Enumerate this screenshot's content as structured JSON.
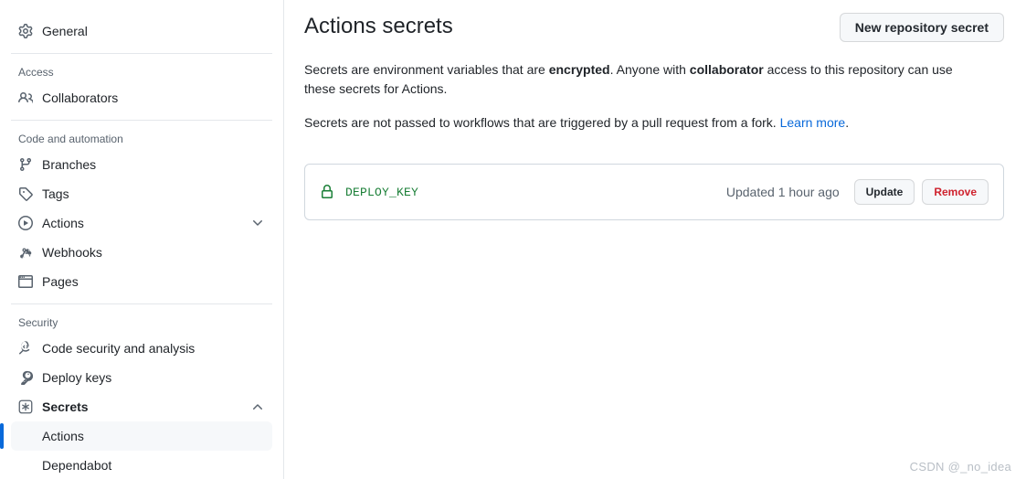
{
  "sidebar": {
    "top_items": [
      {
        "label": "General",
        "icon": "gear-icon",
        "key": "general"
      }
    ],
    "sections": [
      {
        "title": "Access",
        "items": [
          {
            "label": "Collaborators",
            "icon": "people-icon",
            "key": "collaborators"
          }
        ]
      },
      {
        "title": "Code and automation",
        "items": [
          {
            "label": "Branches",
            "icon": "branch-icon",
            "key": "branches"
          },
          {
            "label": "Tags",
            "icon": "tag-icon",
            "key": "tags"
          },
          {
            "label": "Actions",
            "icon": "play-icon",
            "key": "actions",
            "chevron": "chevron-down-icon"
          },
          {
            "label": "Webhooks",
            "icon": "webhook-icon",
            "key": "webhooks"
          },
          {
            "label": "Pages",
            "icon": "browser-icon",
            "key": "pages"
          }
        ]
      },
      {
        "title": "Security",
        "items": [
          {
            "label": "Code security and analysis",
            "icon": "codescan-icon",
            "key": "code-security-and-analysis"
          },
          {
            "label": "Deploy keys",
            "icon": "key-icon",
            "key": "deploy-keys"
          },
          {
            "label": "Secrets",
            "icon": "asterisk-icon",
            "key": "secrets",
            "chevron": "chevron-up-icon",
            "bold": true
          }
        ],
        "sub_items": [
          {
            "label": "Actions",
            "key": "secrets-actions",
            "selected": true
          },
          {
            "label": "Dependabot",
            "key": "secrets-dependabot",
            "selected": false
          }
        ]
      }
    ]
  },
  "main": {
    "title": "Actions secrets",
    "new_secret_button": "New repository secret",
    "description_1": {
      "part1": "Secrets are environment variables that are ",
      "bold1": "encrypted",
      "part2": ". Anyone with ",
      "bold2": "collaborator",
      "part3": " access to this repository can use these secrets for Actions."
    },
    "description_2": {
      "text": "Secrets are not passed to workflows that are triggered by a pull request from a fork. ",
      "link": "Learn more",
      "suffix": "."
    },
    "secrets": [
      {
        "name": "DEPLOY_KEY",
        "updated": "Updated 1 hour ago",
        "update_label": "Update",
        "remove_label": "Remove"
      }
    ]
  },
  "watermark": "CSDN @_no_idea",
  "colors": {
    "accent": "#0969da",
    "success": "#1a7f37",
    "danger": "#cf222e",
    "border": "#d0d7de",
    "muted": "#59636e"
  }
}
